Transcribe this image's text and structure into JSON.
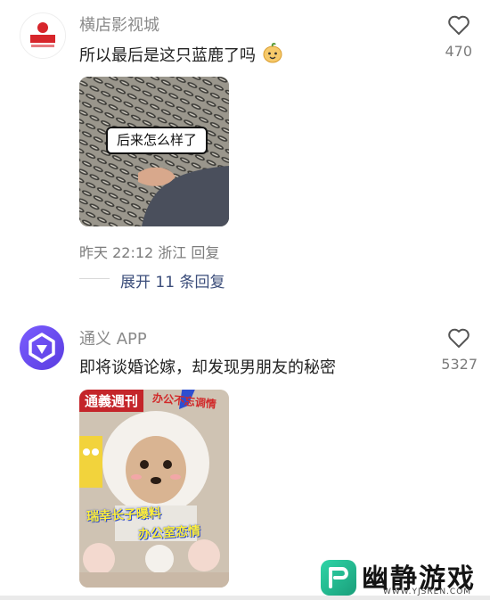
{
  "comments": [
    {
      "author": "横店影视城",
      "avatar_icon": "hengdian-logo",
      "text": "所以最后是这只蓝鹿了吗",
      "emoji": "smiling-pear-emoji",
      "like_count": "470",
      "image_caption": "后来怎么样了",
      "meta": "昨天 22:12 浙江 回复",
      "expand_replies": "展开 11 条回复"
    },
    {
      "author": "通义 APP",
      "avatar_icon": "tongyi-logo",
      "text": "即将谈婚论嫁，却发现男朋友的秘密",
      "like_count": "5327",
      "image_banner": "通義週刊",
      "image_tag": "办公不忘调情",
      "image_headline_1": "瑞幸长子曝料",
      "image_headline_2": "办公室恋情"
    }
  ],
  "watermark": {
    "title": "幽静游戏",
    "url": "WWW.YJSREN.COM"
  },
  "colors": {
    "accent_link": "#3b4d7a",
    "muted": "#8a8a8a",
    "tongyi_purple": "#6a4cff"
  }
}
